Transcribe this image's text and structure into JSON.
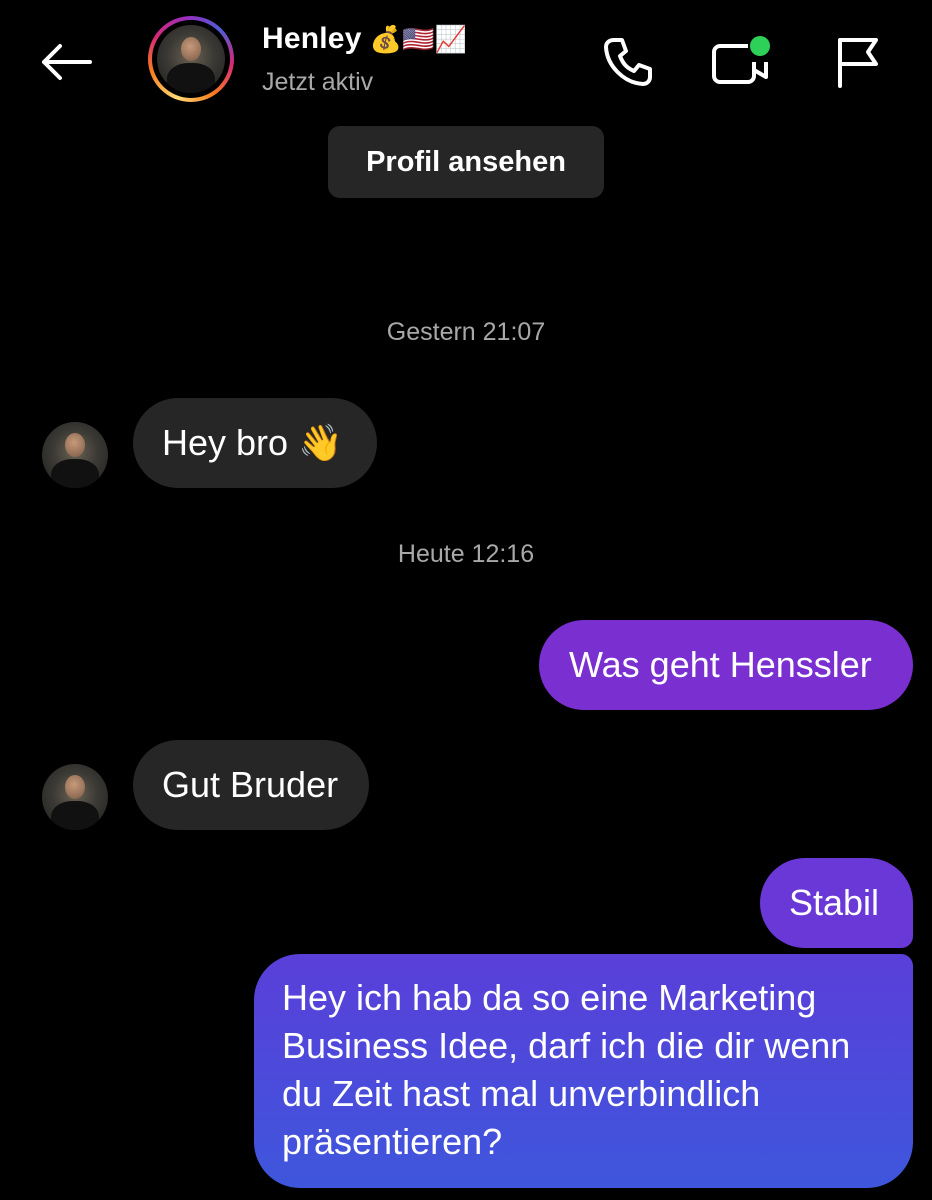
{
  "header": {
    "contact_name": "Henley",
    "name_emojis": "💰🇺🇸📈",
    "status": "Jetzt aktiv",
    "back_icon": "arrow-left-icon",
    "call_icon": "phone-icon",
    "video_icon": "video-camera-icon",
    "report_icon": "flag-icon",
    "online_dot_color": "#2ed158"
  },
  "profile_button": {
    "label": "Profil ansehen"
  },
  "messages": [
    {
      "type": "timestamp",
      "text": "Gestern 21:07"
    },
    {
      "type": "incoming",
      "text": "Hey bro 👋"
    },
    {
      "type": "timestamp",
      "text": "Heute 12:16"
    },
    {
      "type": "outgoing",
      "text": "Was geht Henssler"
    },
    {
      "type": "incoming",
      "text": "Gut Bruder"
    },
    {
      "type": "outgoing",
      "text": "Stabil"
    },
    {
      "type": "outgoing",
      "lines": [
        "Hey ich hab da so eine Marketing",
        "Business Idee, darf ich die dir wenn",
        "du Zeit hast mal unverbindlich",
        "präsentieren?"
      ]
    }
  ],
  "colors": {
    "background": "#000000",
    "incoming_bubble": "#262626",
    "outgoing_purple": "#7a2fd0",
    "outgoing_blue": "#3e56dc",
    "secondary_text": "#a8a8a8"
  }
}
